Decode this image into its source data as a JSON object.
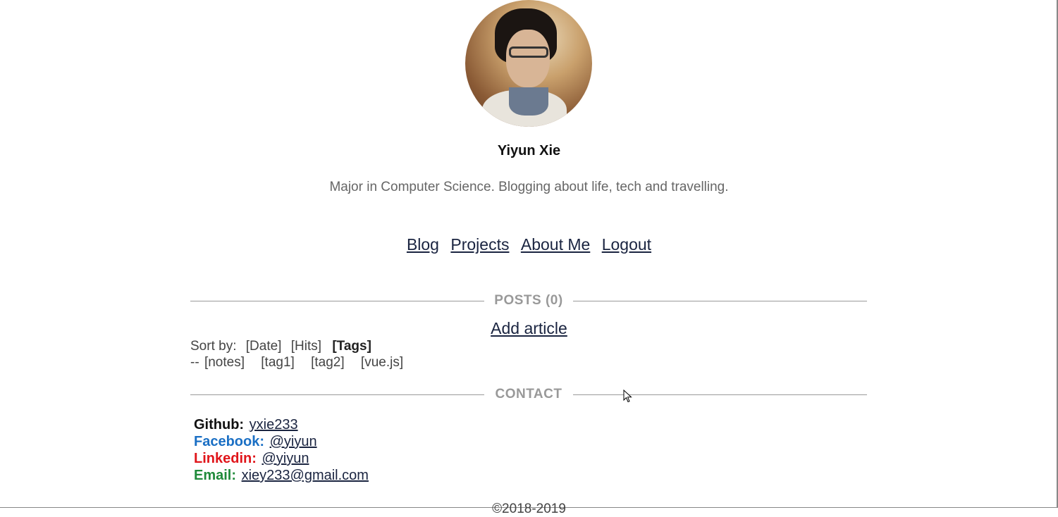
{
  "profile": {
    "name": "Yiyun Xie",
    "bio": "Major in Computer Science. Blogging about life, tech and travelling."
  },
  "nav": {
    "items": [
      "Blog",
      "Projects",
      "About Me",
      "Logout"
    ]
  },
  "posts": {
    "title": "POSTS (0)",
    "add_article": "Add article",
    "sort_label": "Sort by:",
    "sort_options": [
      "[Date]",
      "[Hits]"
    ],
    "sort_active": "[Tags]",
    "tag_prefix": "--",
    "tags": [
      "[notes]",
      "[tag1]",
      "[tag2]",
      "[vue.js]"
    ]
  },
  "contact": {
    "title": "CONTACT",
    "items": [
      {
        "label": "Github:",
        "value": "yxie233",
        "color": "#111111"
      },
      {
        "label": "Facebook:",
        "value": "@yiyun",
        "color": "#1a6fc4"
      },
      {
        "label": "Linkedin:",
        "value": "@yiyun",
        "color": "#e0151a"
      },
      {
        "label": "Email:",
        "value": "xiey233@gmail.com",
        "color": "#1f8a3a"
      }
    ]
  },
  "footer": {
    "text": "©2018-2019"
  }
}
